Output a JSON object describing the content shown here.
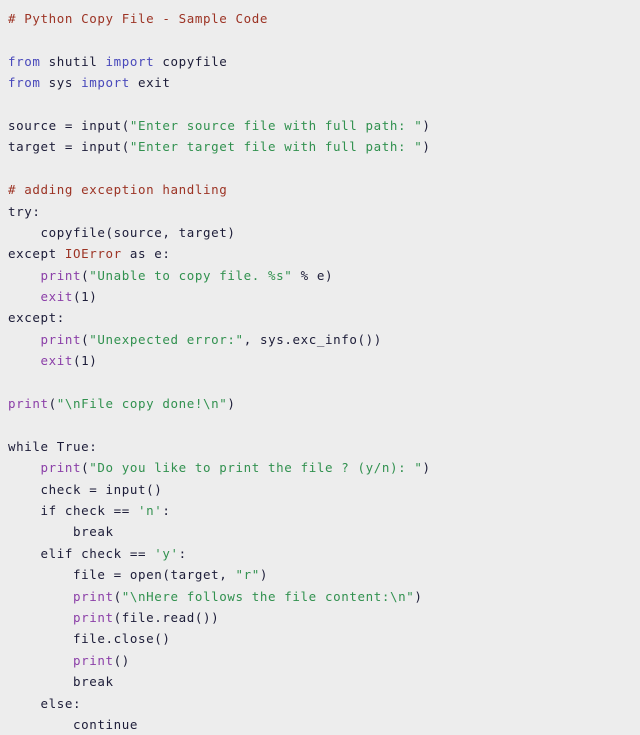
{
  "viewer": {
    "title": "Python Copy File - Sample Code",
    "background_color": "#ededed",
    "language": "python"
  },
  "palette": {
    "comment": "#9c3324",
    "keyword": "#4848bb",
    "string": "#31914f",
    "builtin": "#8b3fa8",
    "exception": "#9c3324",
    "plain": "#1c1c38",
    "background": "#ededed"
  },
  "code": {
    "lines": [
      {
        "indent": 0,
        "tokens": [
          {
            "t": "comment",
            "s": "# Python Copy File - Sample Code"
          }
        ]
      },
      {
        "indent": 0,
        "tokens": []
      },
      {
        "indent": 0,
        "tokens": [
          {
            "t": "keyword",
            "s": "from"
          },
          {
            "t": "plain",
            "s": " shutil "
          },
          {
            "t": "keyword",
            "s": "import"
          },
          {
            "t": "plain",
            "s": " copyfile"
          }
        ]
      },
      {
        "indent": 0,
        "tokens": [
          {
            "t": "keyword",
            "s": "from"
          },
          {
            "t": "plain",
            "s": " sys "
          },
          {
            "t": "keyword",
            "s": "import"
          },
          {
            "t": "plain",
            "s": " exit"
          }
        ]
      },
      {
        "indent": 0,
        "tokens": []
      },
      {
        "indent": 0,
        "tokens": [
          {
            "t": "plain",
            "s": "source = input("
          },
          {
            "t": "string",
            "s": "\"Enter source file with full path: \""
          },
          {
            "t": "plain",
            "s": ")"
          }
        ]
      },
      {
        "indent": 0,
        "tokens": [
          {
            "t": "plain",
            "s": "target = input("
          },
          {
            "t": "string",
            "s": "\"Enter target file with full path: \""
          },
          {
            "t": "plain",
            "s": ")"
          }
        ]
      },
      {
        "indent": 0,
        "tokens": []
      },
      {
        "indent": 0,
        "tokens": [
          {
            "t": "comment",
            "s": "# adding exception handling"
          }
        ]
      },
      {
        "indent": 0,
        "tokens": [
          {
            "t": "plain",
            "s": "try:"
          }
        ]
      },
      {
        "indent": 0,
        "tokens": [
          {
            "t": "plain",
            "s": "    copyfile(source, target)"
          }
        ]
      },
      {
        "indent": 0,
        "tokens": [
          {
            "t": "plain",
            "s": "except "
          },
          {
            "t": "exception",
            "s": "IOError"
          },
          {
            "t": "plain",
            "s": " as e:"
          }
        ]
      },
      {
        "indent": 0,
        "tokens": [
          {
            "t": "plain",
            "s": "    "
          },
          {
            "t": "builtin",
            "s": "print"
          },
          {
            "t": "plain",
            "s": "("
          },
          {
            "t": "string",
            "s": "\"Unable to copy file. %s\""
          },
          {
            "t": "plain",
            "s": " % e)"
          }
        ]
      },
      {
        "indent": 0,
        "tokens": [
          {
            "t": "plain",
            "s": "    "
          },
          {
            "t": "builtin",
            "s": "exit"
          },
          {
            "t": "plain",
            "s": "(1)"
          }
        ]
      },
      {
        "indent": 0,
        "tokens": [
          {
            "t": "plain",
            "s": "except:"
          }
        ]
      },
      {
        "indent": 0,
        "tokens": [
          {
            "t": "plain",
            "s": "    "
          },
          {
            "t": "builtin",
            "s": "print"
          },
          {
            "t": "plain",
            "s": "("
          },
          {
            "t": "string",
            "s": "\"Unexpected error:\""
          },
          {
            "t": "plain",
            "s": ", sys.exc_info())"
          }
        ]
      },
      {
        "indent": 0,
        "tokens": [
          {
            "t": "plain",
            "s": "    "
          },
          {
            "t": "builtin",
            "s": "exit"
          },
          {
            "t": "plain",
            "s": "(1)"
          }
        ]
      },
      {
        "indent": 0,
        "tokens": []
      },
      {
        "indent": 0,
        "tokens": [
          {
            "t": "builtin",
            "s": "print"
          },
          {
            "t": "plain",
            "s": "("
          },
          {
            "t": "string",
            "s": "\"\\nFile copy done!\\n\""
          },
          {
            "t": "plain",
            "s": ")"
          }
        ]
      },
      {
        "indent": 0,
        "tokens": []
      },
      {
        "indent": 0,
        "tokens": [
          {
            "t": "plain",
            "s": "while True:"
          }
        ]
      },
      {
        "indent": 0,
        "tokens": [
          {
            "t": "plain",
            "s": "    "
          },
          {
            "t": "builtin",
            "s": "print"
          },
          {
            "t": "plain",
            "s": "("
          },
          {
            "t": "string",
            "s": "\"Do you like to print the file ? (y/n): \""
          },
          {
            "t": "plain",
            "s": ")"
          }
        ]
      },
      {
        "indent": 0,
        "tokens": [
          {
            "t": "plain",
            "s": "    check = input()"
          }
        ]
      },
      {
        "indent": 0,
        "tokens": [
          {
            "t": "plain",
            "s": "    if check == "
          },
          {
            "t": "string",
            "s": "'n'"
          },
          {
            "t": "plain",
            "s": ":"
          }
        ]
      },
      {
        "indent": 0,
        "tokens": [
          {
            "t": "plain",
            "s": "        break"
          }
        ]
      },
      {
        "indent": 0,
        "tokens": [
          {
            "t": "plain",
            "s": "    elif check == "
          },
          {
            "t": "string",
            "s": "'y'"
          },
          {
            "t": "plain",
            "s": ":"
          }
        ]
      },
      {
        "indent": 0,
        "tokens": [
          {
            "t": "plain",
            "s": "        file = open(target, "
          },
          {
            "t": "string",
            "s": "\"r\""
          },
          {
            "t": "plain",
            "s": ")"
          }
        ]
      },
      {
        "indent": 0,
        "tokens": [
          {
            "t": "plain",
            "s": "        "
          },
          {
            "t": "builtin",
            "s": "print"
          },
          {
            "t": "plain",
            "s": "("
          },
          {
            "t": "string",
            "s": "\"\\nHere follows the file content:\\n\""
          },
          {
            "t": "plain",
            "s": ")"
          }
        ]
      },
      {
        "indent": 0,
        "tokens": [
          {
            "t": "plain",
            "s": "        "
          },
          {
            "t": "builtin",
            "s": "print"
          },
          {
            "t": "plain",
            "s": "(file.read())"
          }
        ]
      },
      {
        "indent": 0,
        "tokens": [
          {
            "t": "plain",
            "s": "        file.close()"
          }
        ]
      },
      {
        "indent": 0,
        "tokens": [
          {
            "t": "plain",
            "s": "        "
          },
          {
            "t": "builtin",
            "s": "print"
          },
          {
            "t": "plain",
            "s": "()"
          }
        ]
      },
      {
        "indent": 0,
        "tokens": [
          {
            "t": "plain",
            "s": "        break"
          }
        ]
      },
      {
        "indent": 0,
        "tokens": [
          {
            "t": "plain",
            "s": "    else:"
          }
        ]
      },
      {
        "indent": 0,
        "tokens": [
          {
            "t": "plain",
            "s": "        continue"
          }
        ]
      }
    ]
  }
}
